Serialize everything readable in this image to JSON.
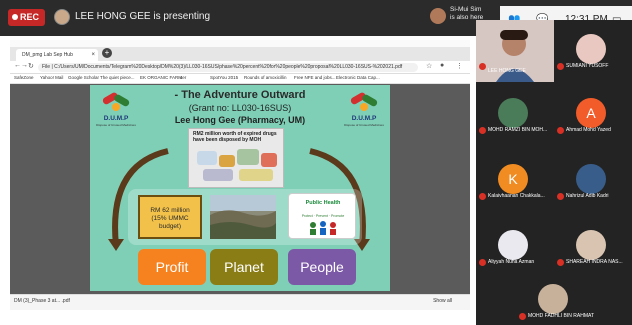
{
  "meeting": {
    "rec_label": "REC",
    "presenting_text": "LEE HONG GEE is presenting",
    "speaker_text_line1": "Si-Mui Sim",
    "speaker_text_line2": "is also here",
    "time": "12:31 PM"
  },
  "browser": {
    "tab_title": "DM_pmg Lab Sep Hub presentatio...",
    "url": "File | C:/Users/UM/Documents/Telegram%20Desktop/DM%20(3)/LL030-16SUS/phase%20percent%20for%20people%20proposal%20LL030-16SUS-%202021.pdf",
    "bookmarks": [
      "SafeZone",
      "Yahoo! Mail",
      "Google Scholar",
      "The quiet piece...",
      "EK ORGANIC FARM",
      "ser",
      "SpotYou 2015",
      "Rounds of amoxicillin",
      "Free NFE and jobs...",
      "Electronic Data Cap..."
    ],
    "download_item": "DM (3)_Phase 3 at... .pdf",
    "show_all": "Show all"
  },
  "slide": {
    "title": "- The Adventure Outward",
    "grant": "(Grant no: LL030-16SUS)",
    "lead": "Lee Hong Gee (Pharmacy, UM)",
    "logo_label": "D.U.M.P",
    "logo_sub": "Dispose of Unused Medicines",
    "photo_caption": "RM2 million worth of expired drugs have been disposed by MOH",
    "money_text": "RM 62 million (15% UMMC budget)",
    "public_health": "Public Health",
    "public_health_sub": "Protect · Prevent · Promote",
    "profit": "Profit",
    "planet": "Planet",
    "people": "People"
  },
  "participants": [
    {
      "name": "LEE HONG GEE",
      "type": "video"
    },
    {
      "name": "SUMIANI YUSOFF",
      "type": "photo",
      "color": "#e8c8c0"
    },
    {
      "name": "MOHD RAMZI BIN MOH...",
      "type": "photo",
      "color": "#4a7c59"
    },
    {
      "name": "Ahmad Mohd Yazed",
      "type": "initial",
      "initial": "A",
      "color": "#f25c2a"
    },
    {
      "name": "Kalaivhaanan Chakkala...",
      "type": "initial",
      "initial": "K",
      "color": "#f08c22"
    },
    {
      "name": "Nahrizul Adib Kadri",
      "type": "photo",
      "color": "#395d8a"
    },
    {
      "name": "Aliyyah Nuha Azman",
      "type": "photo",
      "color": "#e9e9ef"
    },
    {
      "name": "SHAREAH INDRA NAS...",
      "type": "photo",
      "color": "#d8c4b0"
    },
    {
      "name": "MOHD FADHLI BIN RAHMAT FAKRI",
      "type": "photo",
      "color": "#c7b19a"
    }
  ]
}
